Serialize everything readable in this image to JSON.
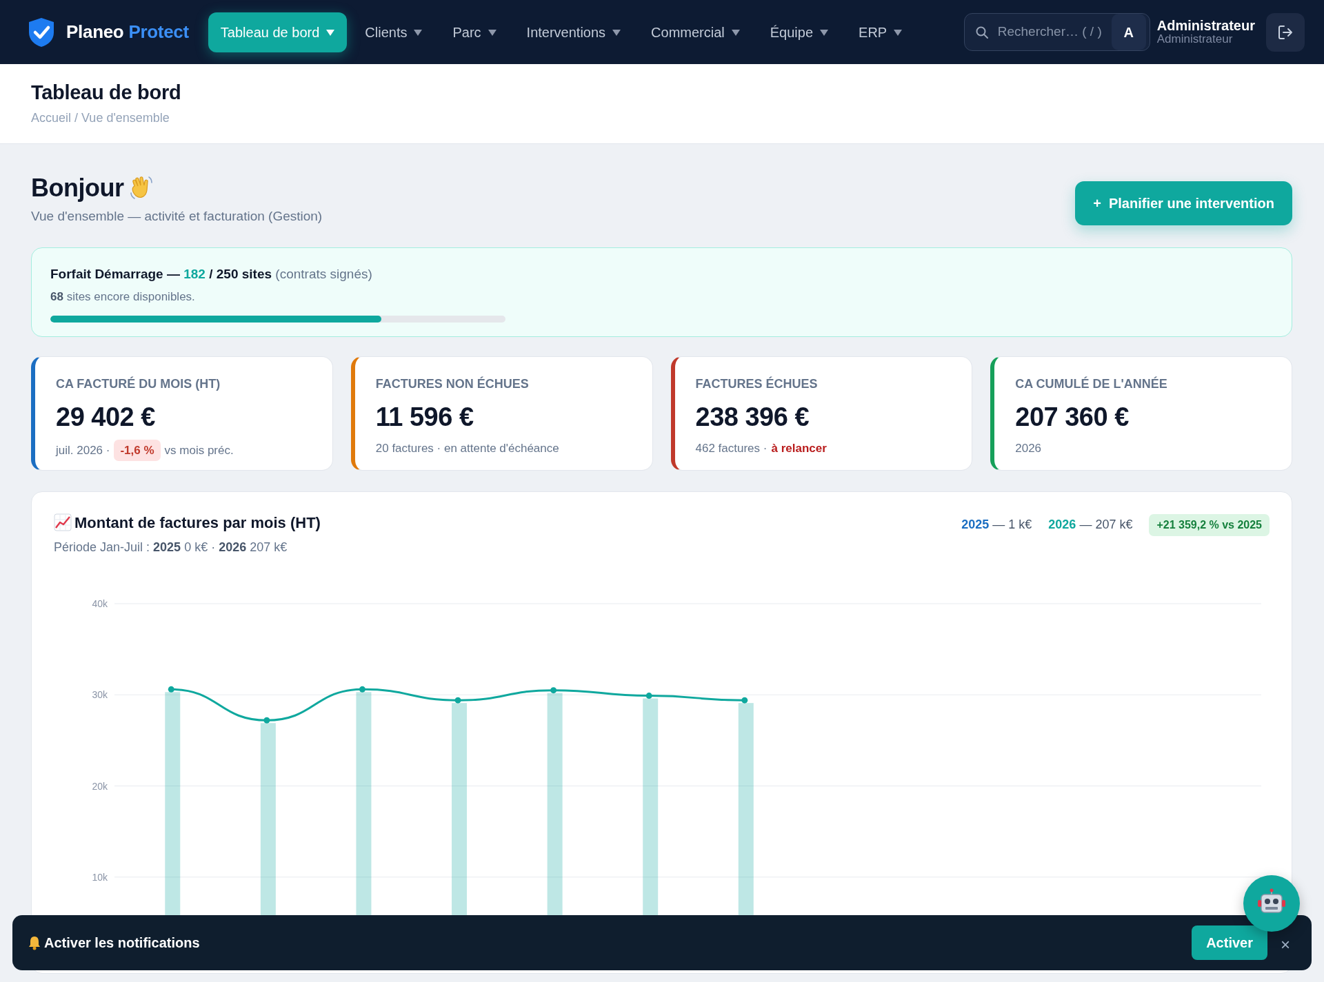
{
  "brand": {
    "name": "Planeo",
    "accent": "Protect"
  },
  "nav": [
    {
      "label": "Tableau de bord",
      "selected": true
    },
    {
      "label": "Clients",
      "selected": false
    },
    {
      "label": "Parc",
      "selected": false
    },
    {
      "label": "Interventions",
      "selected": false
    },
    {
      "label": "Commercial",
      "selected": false
    },
    {
      "label": "Équipe",
      "selected": false
    },
    {
      "label": "ERP",
      "selected": false
    }
  ],
  "search": {
    "placeholder": "Rechercher… ( / )"
  },
  "user": {
    "initial": "A",
    "name": "Administrateur",
    "role": "Administrateur"
  },
  "page_header": {
    "title": "Tableau de bord",
    "breadcrumb": "Accueil / Vue d'ensemble"
  },
  "greeting": {
    "title": "Bonjour",
    "subtitle": "Vue d'ensemble — activité et facturation (Gestion)",
    "button": "+  Planifier une intervention"
  },
  "plan": {
    "text": "Forfait Démarrage —",
    "used": "182",
    "total": "/ 250 sites",
    "note": "(contrats signés)",
    "remaining": "**68** sites encore disponibles.",
    "level": 0.728
  },
  "kpis": [
    {
      "label": "CA FACTURÉ DU MOIS (HT)",
      "value": "29 402 €",
      "color": "#1b6ec2",
      "parts": [
        {
          "kind": "text",
          "text": "juil. 2026 ·"
        },
        {
          "kind": "badge",
          "text": "-1,6 %"
        },
        {
          "kind": "text",
          "text": "vs mois préc."
        }
      ]
    },
    {
      "label": "FACTURES NON ÉCHUES",
      "value": "11 596 €",
      "color": "#e07a0c",
      "parts": [
        {
          "kind": "text",
          "text": "20 factures · en attente d'échéance"
        }
      ]
    },
    {
      "label": "FACTURES ÉCHUES",
      "value": "238 396 €",
      "color": "#c0392b",
      "parts": [
        {
          "kind": "text",
          "text": "462 factures ·"
        },
        {
          "kind": "alert",
          "text": "à relancer"
        }
      ]
    },
    {
      "label": "CA CUMULÉ DE L'ANNÉE",
      "value": "207 360 €",
      "color": "#16a05a",
      "parts": [
        {
          "kind": "text",
          "text": "2026"
        }
      ]
    }
  ],
  "chart_panel": {
    "title": "Montant de factures par mois (HT)",
    "subtitle": "Période Jan-Juil : **2025** 0 k€ · **2026** 207 k€",
    "legend": [
      {
        "year": "2025",
        "text": "— 1 k€",
        "color": "#1b6ec2"
      },
      {
        "text": "— 207 k€",
        "color": "#0fa89e"
      }
    ],
    "badge": "+21 359,2 % vs 2025",
    "chart_data": {
      "type": "bar",
      "grid": true,
      "ylim": [
        0,
        40000
      ],
      "yticks": [
        {
          "value": 10000,
          "label": "10k"
        },
        {
          "value": 20000,
          "label": "20k"
        },
        {
          "value": 30000,
          "label": "30k"
        },
        {
          "value": 40000,
          "label": "40k"
        }
      ],
      "series": [
        {
          "name": "2026",
          "color": "#0fa89e",
          "values": [
            30300,
            26900,
            30300,
            29100,
            30200,
            29600,
            29100,
            null,
            null,
            null,
            null,
            null
          ]
        },
        {
          "type": "line",
          "marker": true,
          "color": "#0fa89e",
          "values": [
            30600,
            27200,
            30600,
            29400,
            30500,
            29900,
            29400,
            null,
            null,
            null,
            null,
            null
          ]
        }
      ]
    }
  },
  "notification": {
    "text": "Activer les notifications",
    "button": "Activer",
    "close": "×"
  }
}
